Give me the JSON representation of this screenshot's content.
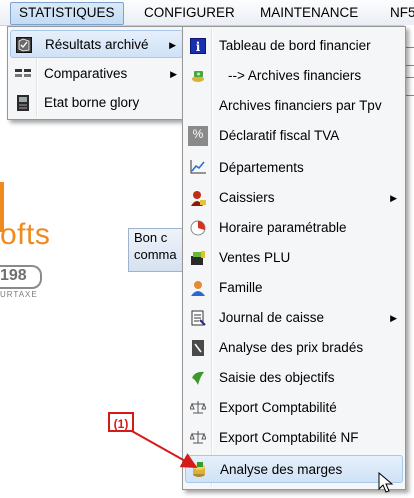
{
  "menubar": {
    "items": [
      "STATISTIQUES",
      "CONFIGURER",
      "MAINTENANCE",
      "NF5"
    ]
  },
  "background": {
    "logo_text": "ofts",
    "logo_number": "198",
    "logo_caption": "URTAXE",
    "button_lines": [
      "Bon c",
      "comma"
    ],
    "brand_color": "#f08a1f"
  },
  "statistiques_menu": {
    "items": [
      {
        "label": "Résultats archivé",
        "icon": "archive-book-icon",
        "submenu": true,
        "highlighted": true
      },
      {
        "label": "Comparatives",
        "icon": "compare-grid-icon",
        "submenu": true,
        "highlighted": false
      },
      {
        "label": "Etat borne glory",
        "icon": "terminal-icon",
        "submenu": false,
        "highlighted": false
      }
    ]
  },
  "archives_submenu": {
    "items": [
      {
        "label": "Tableau de bord financier",
        "icon": "info-icon",
        "submenu": false
      },
      {
        "label": "--> Archives financiers",
        "icon": "money-icon",
        "submenu": false
      },
      {
        "label": "Archives financiers par Tpv",
        "icon": "",
        "submenu": false
      },
      {
        "label": "Déclaratif fiscal TVA",
        "icon": "percent-icon",
        "submenu": false
      },
      {
        "label": "Départements",
        "icon": "line-chart-icon",
        "submenu": false
      },
      {
        "label": "Caissiers",
        "icon": "cashier-icon",
        "submenu": true
      },
      {
        "label": "Horaire paramétrable",
        "icon": "clock-pie-icon",
        "submenu": false
      },
      {
        "label": "Ventes PLU",
        "icon": "cash-register-icon",
        "submenu": false
      },
      {
        "label": "Famille",
        "icon": "user-icon",
        "submenu": false
      },
      {
        "label": "Journal de caisse",
        "icon": "journal-icon",
        "submenu": true
      },
      {
        "label": "Analyse des prix bradés",
        "icon": "price-tag-icon",
        "submenu": false
      },
      {
        "label": "Saisie des objectifs",
        "icon": "target-icon",
        "submenu": false
      },
      {
        "label": "Export Comptabilité",
        "icon": "scale-icon",
        "submenu": false
      },
      {
        "label": "Export Comptabilité NF",
        "icon": "scale-icon",
        "submenu": false
      },
      {
        "label": "Analyse des marges",
        "icon": "margin-analysis-icon",
        "submenu": false,
        "highlighted": true
      }
    ]
  },
  "annotation": {
    "label": "(1)",
    "color": "#d51a1a"
  }
}
